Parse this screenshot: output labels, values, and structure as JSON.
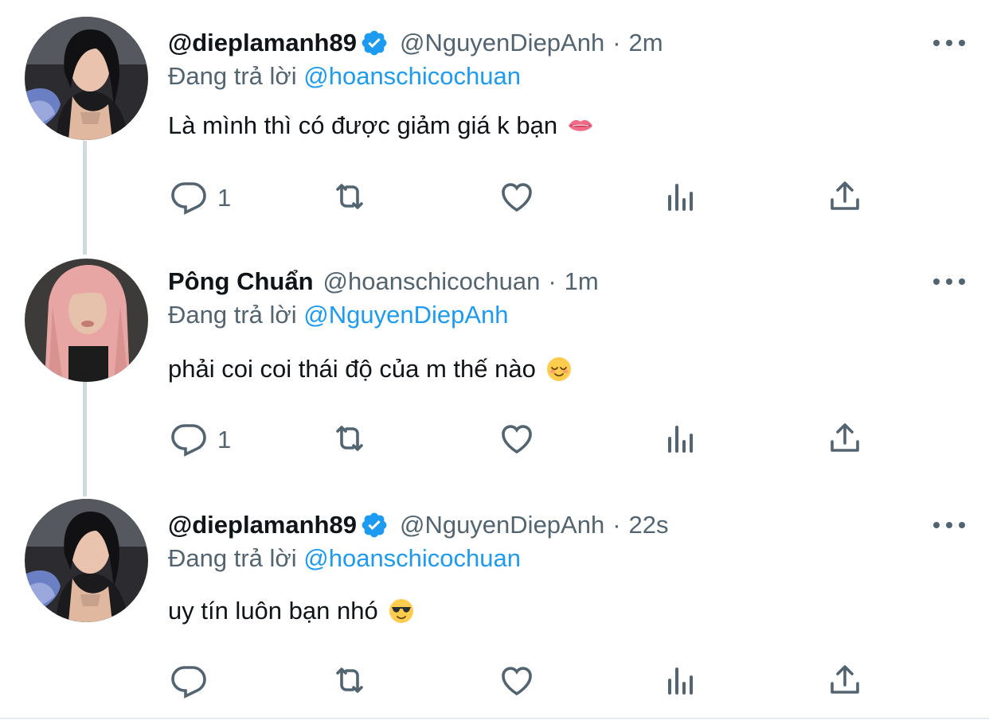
{
  "tweets": [
    {
      "display_name": "@dieplamanh89",
      "verified": true,
      "handle": "@NguyenDiepAnh",
      "time": "2m",
      "reply_prefix": "Đang trả lời",
      "reply_to": "@hoanschicochuan",
      "text": "Là mình thì có được giảm giá k bạn",
      "emoji": "lips",
      "reply_count": "1",
      "avatar": "woman-dark-hair-avatar"
    },
    {
      "display_name": "Pông Chuẩn",
      "verified": false,
      "handle": "@hoanschicochuan",
      "time": "1m",
      "reply_prefix": "Đang trả lời",
      "reply_to": "@NguyenDiepAnh",
      "text": "phải coi coi thái độ của m thế nào",
      "emoji": "relieved-face",
      "reply_count": "1",
      "avatar": "woman-pink-hair-avatar"
    },
    {
      "display_name": "@dieplamanh89",
      "verified": true,
      "handle": "@NguyenDiepAnh",
      "time": "22s",
      "reply_prefix": "Đang trả lời",
      "reply_to": "@hoanschicochuan",
      "text": "uy tín luôn bạn nhó",
      "emoji": "sunglasses-face",
      "reply_count": "",
      "avatar": "woman-dark-hair-avatar"
    }
  ],
  "meta_separator": "·",
  "colors": {
    "link": "#1d9bf0",
    "secondary_text": "#536471",
    "primary_text": "#0f1419",
    "thread_line": "#cfd9de",
    "verified_badge": "#1d9bf0"
  }
}
